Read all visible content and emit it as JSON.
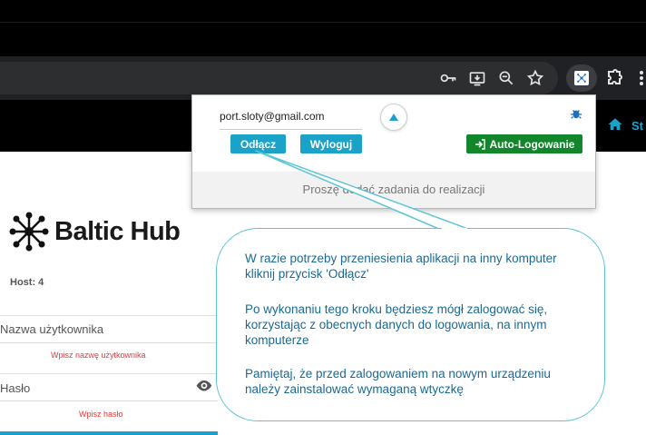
{
  "browser": {
    "toolbar_icons": [
      "key-icon",
      "install-app-icon",
      "zoom-icon",
      "bookmark-star-icon"
    ],
    "extension_icon": "baltic-hub-extension-icon",
    "extensions_icon": "puzzle-icon"
  },
  "site": {
    "nav_label": "St",
    "logo_text": "Baltic Hub",
    "host_label": "Host: 4",
    "username_placeholder": "Nazwa użytkownika",
    "username_error": "Wpisz nazwę użytkownika",
    "password_placeholder": "Hasło",
    "password_error": "Wpisz hasło"
  },
  "popup": {
    "email": "port.sloty@gmail.com",
    "disconnect_label": "Odłącz",
    "logout_label": "Wyloguj",
    "autologin_label": "Auto-Logowanie",
    "tasks_text": "Proszę dodać zadania do realizacji"
  },
  "callout": {
    "paragraph1": "W razie potrzeby przeniesienia aplikacji na inny komputer kliknij przycisk 'Odłącz'",
    "paragraph2": "Po wykonaniu tego kroku będziesz mógł zalogować się, korzystając z obecnych danych do logowania, na innym komputerze",
    "paragraph3": "Pamiętaj, że przed zalogowaniem na nowym urządzeniu należy zainstalować wymaganą wtyczkę"
  },
  "colors": {
    "accent": "#1aa2c9",
    "success": "#11862a",
    "error": "#e03c3c",
    "callout_border": "#5ec4d4",
    "callout_text": "#1a6a94"
  }
}
